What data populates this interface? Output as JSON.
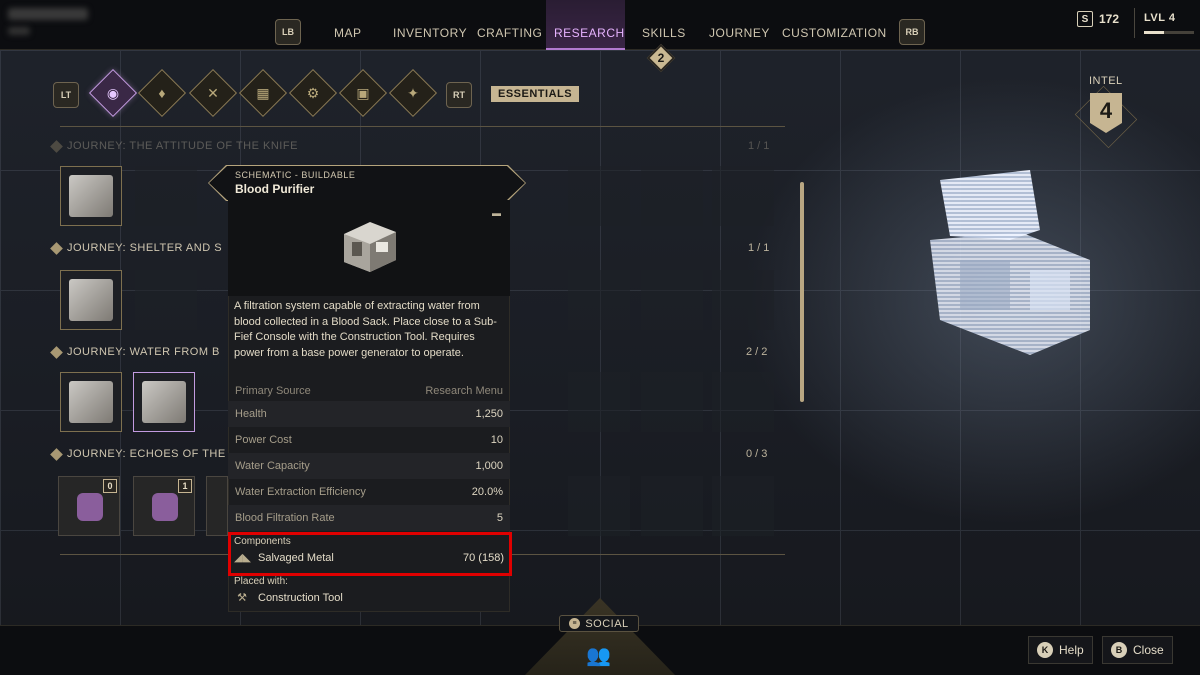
{
  "topbar": {
    "left_bumper": "LB",
    "right_bumper": "RB",
    "tabs": [
      {
        "label": "MAP"
      },
      {
        "label": "INVENTORY"
      },
      {
        "label": "CRAFTING"
      },
      {
        "label": "RESEARCH"
      },
      {
        "label": "SKILLS"
      },
      {
        "label": "JOURNEY"
      },
      {
        "label": "CUSTOMIZATION"
      }
    ],
    "active_tab": "RESEARCH",
    "skills_badge": "2",
    "currency_icon": "S",
    "currency": "172",
    "level": "LVL 4",
    "level_progress": 0.4
  },
  "categories": {
    "left_trigger": "LT",
    "right_trigger": "RT",
    "icons": [
      "essentials-icon",
      "water-drop-icon",
      "crossed-tools-icon",
      "bricks-icon",
      "gear-icon",
      "vehicle-icon",
      "network-icon"
    ],
    "active_label": "ESSENTIALS"
  },
  "sections": [
    {
      "title": "JOURNEY: THE ATTITUDE OF THE KNIFE",
      "count": "1 / 1"
    },
    {
      "title": "JOURNEY: SHELTER AND S",
      "count": "1 / 1"
    },
    {
      "title": "JOURNEY: WATER FROM B",
      "count": "2 / 2"
    },
    {
      "title": "JOURNEY: ECHOES OF THE",
      "count": "0 / 3"
    }
  ],
  "locked_counts": [
    "0",
    "1"
  ],
  "tooltip": {
    "type": "SCHEMATIC - BUILDABLE",
    "title": "Blood Purifier",
    "description": "A filtration system capable of extracting water from blood collected in a Blood Sack. Place close to a Sub-Fief Console with the Construction Tool. Requires power from a base power generator to operate.",
    "source": {
      "label": "Primary Source",
      "value": "Research Menu"
    },
    "stats": [
      {
        "label": "Health",
        "value": "1,250"
      },
      {
        "label": "Power Cost",
        "value": "10"
      },
      {
        "label": "Water Capacity",
        "value": "1,000"
      },
      {
        "label": "Water Extraction Efficiency",
        "value": "20.0%"
      },
      {
        "label": "Blood Filtration Rate",
        "value": "5"
      }
    ],
    "components_label": "Components",
    "component": {
      "name": "Salvaged Metal",
      "qty": "70 (158)",
      "icon": "metal-scrap-icon"
    },
    "placed_with_label": "Placed with:",
    "tool": {
      "name": "Construction Tool",
      "icon": "construction-tool-icon"
    }
  },
  "intel": {
    "label": "INTEL",
    "value": "4"
  },
  "footer": {
    "social_key": "≡",
    "social": "SOCIAL",
    "help_key": "K",
    "help": "Help",
    "close_key": "B",
    "close": "Close"
  },
  "colors": {
    "accent_gold": "#c6b592",
    "active_purple": "#e6b3ff",
    "highlight_red": "#e00000"
  }
}
